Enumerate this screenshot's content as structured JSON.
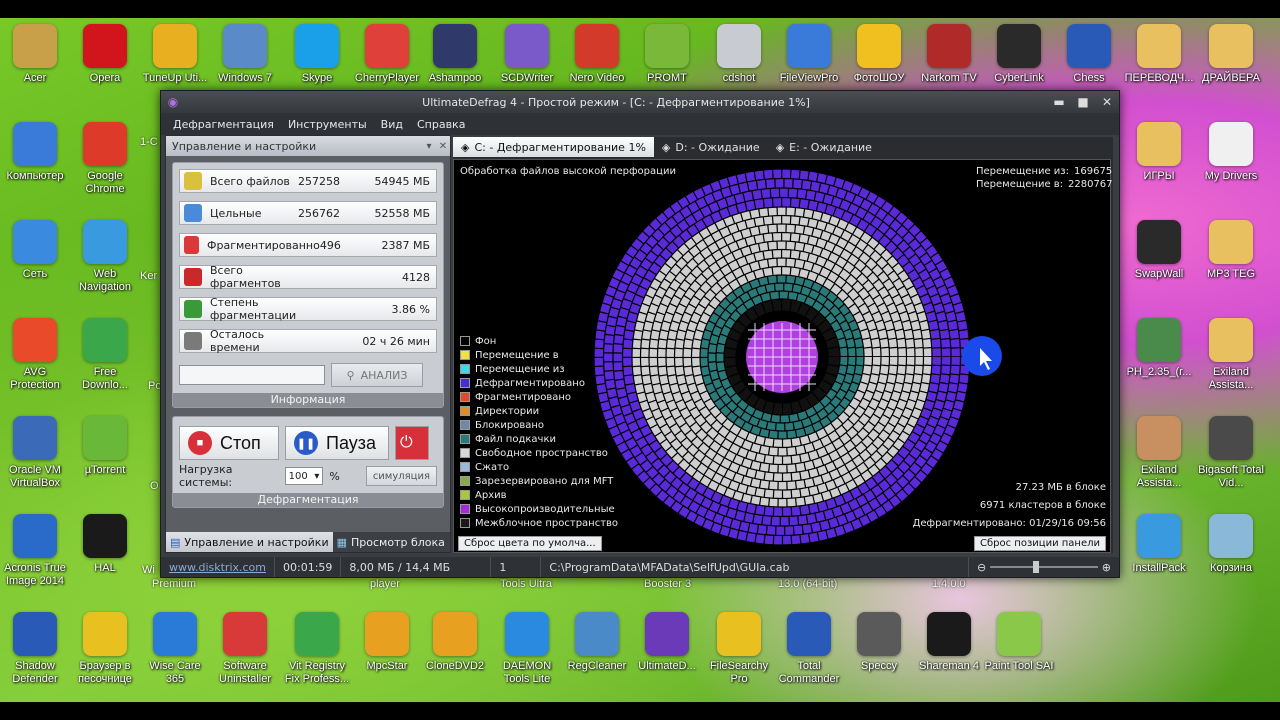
{
  "desktop_icons": [
    {
      "label": "Acer",
      "color": "#c8a04a"
    },
    {
      "label": "Opera",
      "color": "#d2141d"
    },
    {
      "label": "TuneUp Uti...",
      "color": "#e8b020"
    },
    {
      "label": "Windows 7",
      "color": "#5a8ac8"
    },
    {
      "label": "Skype",
      "color": "#1aa0e8"
    },
    {
      "label": "CherryPlayer",
      "color": "#e0403a"
    },
    {
      "label": "Ashampoo",
      "color": "#303a6a"
    },
    {
      "label": "SCDWriter",
      "color": "#7a5ac8"
    },
    {
      "label": "Nero Video",
      "color": "#d43a2a"
    },
    {
      "label": "PROMT",
      "color": "#7ab83a"
    },
    {
      "label": "cdshot",
      "color": "#c8ccd2"
    },
    {
      "label": "FileViewPro",
      "color": "#3a7ad8"
    },
    {
      "label": "ФотоШОУ",
      "color": "#f0c020"
    },
    {
      "label": "Narkom TV",
      "color": "#b02a2a"
    },
    {
      "label": "CyberLink",
      "color": "#2a2a2a"
    },
    {
      "label": "Chess",
      "color": "#2a5ab8"
    },
    {
      "label": "ПЕРЕВОДЧ...",
      "color": "#e8c060"
    },
    {
      "label": "ДРАЙВЕРА",
      "color": "#e8c060"
    },
    {
      "label": "Компьютер",
      "color": "#3a7ad8"
    },
    {
      "label": "Google Chrome",
      "color": "#dd3a2a"
    },
    {
      "label": "ИГРЫ",
      "color": "#e8c060"
    },
    {
      "label": "My Drivers",
      "color": "#f0f0f0"
    },
    {
      "label": "Сеть",
      "color": "#3a8ae0"
    },
    {
      "label": "Web Navigation",
      "color": "#3a9ae0"
    },
    {
      "label": "SwapWall",
      "color": "#2a2a2a"
    },
    {
      "label": "MP3 TEG",
      "color": "#e8c060"
    },
    {
      "label": "AVG Protection",
      "color": "#e84a2a"
    },
    {
      "label": "Free Downlo...",
      "color": "#3aa84a"
    },
    {
      "label": "PH_2.35_(r...",
      "color": "#4a8a4a"
    },
    {
      "label": "Exiland Assista...",
      "color": "#e8c060"
    },
    {
      "label": "Oracle VM VirtualBox",
      "color": "#3a6ab8"
    },
    {
      "label": "µTorrent",
      "color": "#6ab83a"
    },
    {
      "label": "Exiland Assista...",
      "color": "#c89060"
    },
    {
      "label": "Bigasoft Total Vid...",
      "color": "#4a4a4a"
    },
    {
      "label": "Acronis True Image 2014",
      "color": "#2a6ac8"
    },
    {
      "label": "HAL",
      "color": "#1a1a1a"
    },
    {
      "label": "InstallPack",
      "color": "#3a9ae0"
    },
    {
      "label": "Корзина",
      "color": "#8ab8d8"
    },
    {
      "label": "Shadow Defender",
      "color": "#2a5ab8"
    },
    {
      "label": "Браузер в песочнице",
      "color": "#e8c020"
    },
    {
      "label": "Wise Care 365",
      "color": "#2a7ad8"
    },
    {
      "label": "Software Uninstaller",
      "color": "#d83a3a"
    },
    {
      "label": "Vit Registry Fix Profess...",
      "color": "#3aa84a"
    },
    {
      "label": "MpcStar",
      "color": "#e8a020"
    },
    {
      "label": "CloneDVD2",
      "color": "#e8a020"
    },
    {
      "label": "DAEMON Tools Lite",
      "color": "#2a8ae0"
    },
    {
      "label": "RegCleaner",
      "color": "#4a8ac8"
    },
    {
      "label": "UltimateD...",
      "color": "#6a3ab8"
    },
    {
      "label": "FileSearchy Pro",
      "color": "#e8c020"
    },
    {
      "label": "Total Commander",
      "color": "#2a5ab8"
    },
    {
      "label": "Speccy",
      "color": "#5a5a5a"
    },
    {
      "label": "Shareman 4",
      "color": "#1a1a1a"
    },
    {
      "label": "Paint Tool SAI",
      "color": "#8ac84a"
    }
  ],
  "partial_labels": {
    "l1": "1-C",
    "l2": "Ker",
    "l3": "Po",
    "l4": "O",
    "l5": "Wi",
    "l6": "Premium",
    "l7": "player",
    "l8": "Tools Ultra",
    "l9": "Booster 3",
    "l10": "13.0 (64-bit)",
    "l11": "1.4.0.0"
  },
  "window": {
    "title": "UltimateDefrag 4 - Простой режим - [C: - Дефрагментирование 1%]",
    "controls": {
      "minimize": "▬",
      "maximize": "■",
      "close": "✕"
    }
  },
  "menu": [
    "Дефрагментация",
    "Инструменты",
    "Вид",
    "Справка"
  ],
  "left_panel": {
    "header": "Управление и настройки",
    "stats": [
      {
        "label": "Всего файлов",
        "value1": "257258",
        "value2": "54945 МБ",
        "icon_color": "#d8c040"
      },
      {
        "label": "Цельные",
        "value1": "256762",
        "value2": "52558 МБ",
        "icon_color": "#4a8ad8"
      },
      {
        "label": "Фрагментированно",
        "value1": "496",
        "value2": "2387 МБ",
        "icon_color": "#d83a3a"
      },
      {
        "label": "Всего фрагментов",
        "value1": "",
        "value2": "4128",
        "icon_color": "#c82a2a"
      },
      {
        "label": "Степень фрагментации",
        "value1": "",
        "value2": "3.86 %",
        "icon_color": "#3a9a3a"
      },
      {
        "label": "Осталось времени",
        "value1": "",
        "value2": "02 ч 26 мин",
        "icon_color": "#7a7a7a"
      }
    ],
    "analyze_input_value": "",
    "analyze_button": "АНАЛИЗ",
    "info_footer": "Информация",
    "stop_button": "Стоп",
    "pause_button": "Пауза",
    "load_label": "Нагрузка системы:",
    "load_value": "100",
    "load_unit": "%",
    "simulation_button": "симуляция",
    "defrag_footer": "Дефрагментация",
    "tabs": [
      "Управление и настройки",
      "Просмотр блока"
    ]
  },
  "right_panel": {
    "tabs": [
      "C: - Дефрагментирование 1%",
      "D: - Ожидание",
      "E: - Ожидание"
    ],
    "map_title": "Обработка файлов высокой перфорации",
    "move_from_label": "Перемещение из:",
    "move_from_value": "169675",
    "move_to_label": "Перемещение в:",
    "move_to_value": "2280767",
    "legend": [
      {
        "label": "Фон",
        "color": "#000000"
      },
      {
        "label": "Перемещение в",
        "color": "#f0e040"
      },
      {
        "label": "Перемещение из",
        "color": "#40d8e8"
      },
      {
        "label": "Дефрагментировано",
        "color": "#4a2ad8"
      },
      {
        "label": "Фрагментировано",
        "color": "#e04a2a"
      },
      {
        "label": "Директории",
        "color": "#e08a2a"
      },
      {
        "label": "Блокировано",
        "color": "#6a8aa8"
      },
      {
        "label": "Файл подкачки",
        "color": "#2a7a7a"
      },
      {
        "label": "Свободное пространство",
        "color": "#d8d8d8"
      },
      {
        "label": "Сжато",
        "color": "#9ab8d8"
      },
      {
        "label": "Зарезервировано для MFT",
        "color": "#8aa84a"
      },
      {
        "label": "Архив",
        "color": "#a8c83a"
      },
      {
        "label": "Высокопроизводительные",
        "color": "#a82ad8"
      },
      {
        "label": "Межблочное пространство",
        "color": "#1a1a1a"
      }
    ],
    "block_size": "27.23 МБ в блоке",
    "clusters": "6971 кластеров в блоке",
    "defrag_date": "Дефрагментировано: 01/29/16 09:56",
    "reset_color_button": "Сброс цвета по умолча...",
    "reset_position_button": "Сброс позиции панели"
  },
  "status_bar": {
    "link": "www.disktrix.com",
    "time": "00:01:59",
    "memory": "8,00 МБ / 14,4 МБ",
    "count": "1",
    "path": "C:\\ProgramData\\MFAData\\SelfUpd\\GUIa.cab"
  },
  "colors": {
    "ring_outer": "#5a2ad8",
    "ring_free": "#cfcfcf",
    "ring_teal": "#2a7a7a",
    "center_sphere": "#b040e0"
  }
}
